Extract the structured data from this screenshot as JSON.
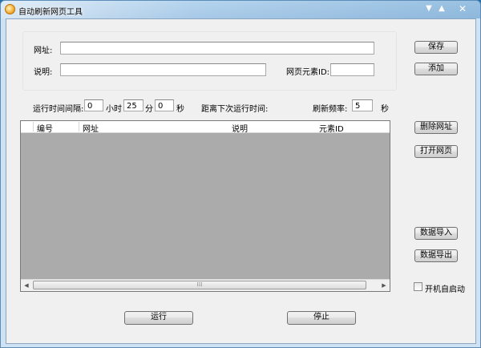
{
  "window": {
    "title": "自动刷新网页工具"
  },
  "form": {
    "url_label": "网址:",
    "url_value": "",
    "desc_label": "说明:",
    "desc_value": "",
    "element_id_label": "网页元素ID:",
    "element_id_value": ""
  },
  "schedule": {
    "interval_label": "运行时间间隔:",
    "hours_value": "0",
    "hours_unit": "小时",
    "minutes_value": "25",
    "minutes_unit": "分",
    "seconds_value": "0",
    "seconds_unit": "秒",
    "next_run_label": "距离下次运行时间:",
    "refresh_rate_label": "刷新频率:",
    "refresh_rate_value": "5",
    "refresh_rate_unit": "秒"
  },
  "table": {
    "columns": [
      "编号",
      "网址",
      "说明",
      "元素ID"
    ],
    "rows": [],
    "scroll_thumb_grip": "⁞⁞⁞"
  },
  "buttons": {
    "save": "保存",
    "add": "添加",
    "delete_url": "删除网址",
    "open_page": "打开网页",
    "import_data": "数据导入",
    "export_data": "数据导出",
    "run": "运行",
    "stop": "停止"
  },
  "autostart": {
    "label": "开机自启动",
    "checked": false
  }
}
